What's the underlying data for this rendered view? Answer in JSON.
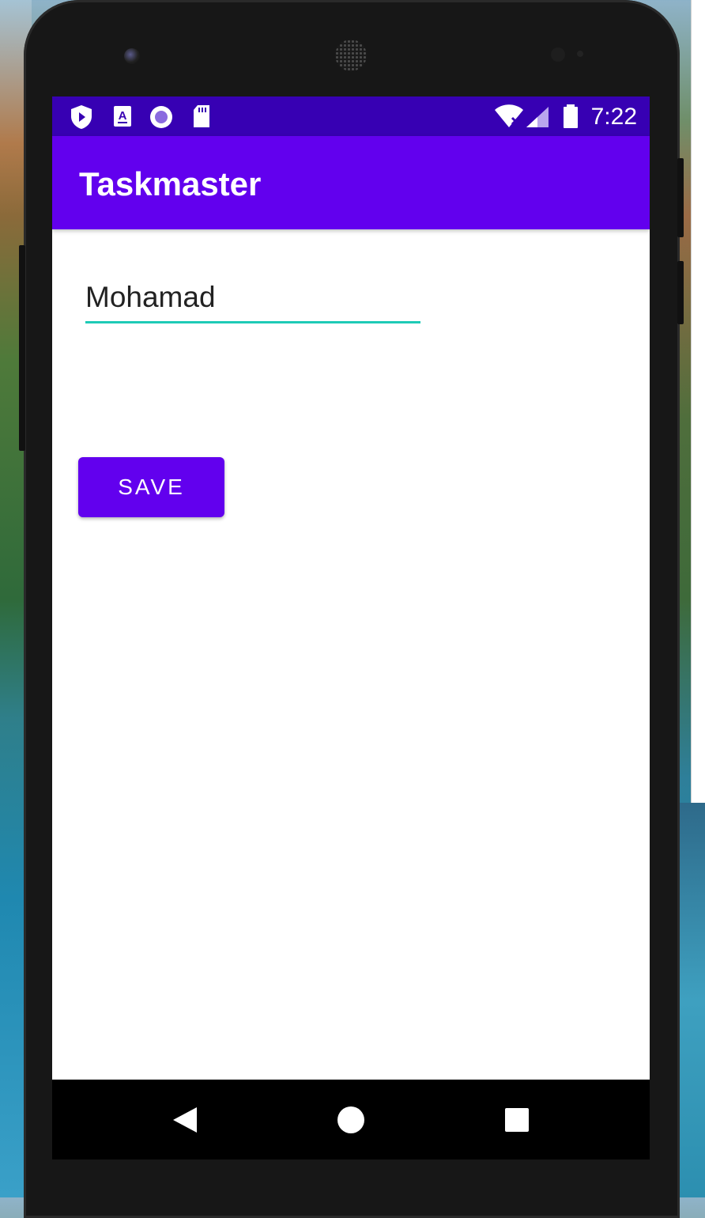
{
  "status_bar": {
    "time": "7:22",
    "left_icons": [
      "play-shield-icon",
      "font-a-icon",
      "record-circle-icon",
      "sd-card-icon"
    ],
    "right_icons": [
      "wifi-off-icon",
      "signal-icon",
      "battery-icon"
    ],
    "background_color": "#3700b3"
  },
  "app_bar": {
    "title": "Taskmaster",
    "background_color": "#6200ee"
  },
  "form": {
    "name_value": "Mohamad",
    "underline_color": "#1ecbb6",
    "save_label": "SAVE"
  },
  "nav_bar": {
    "icons": [
      "back-icon",
      "home-icon",
      "recents-icon"
    ]
  }
}
